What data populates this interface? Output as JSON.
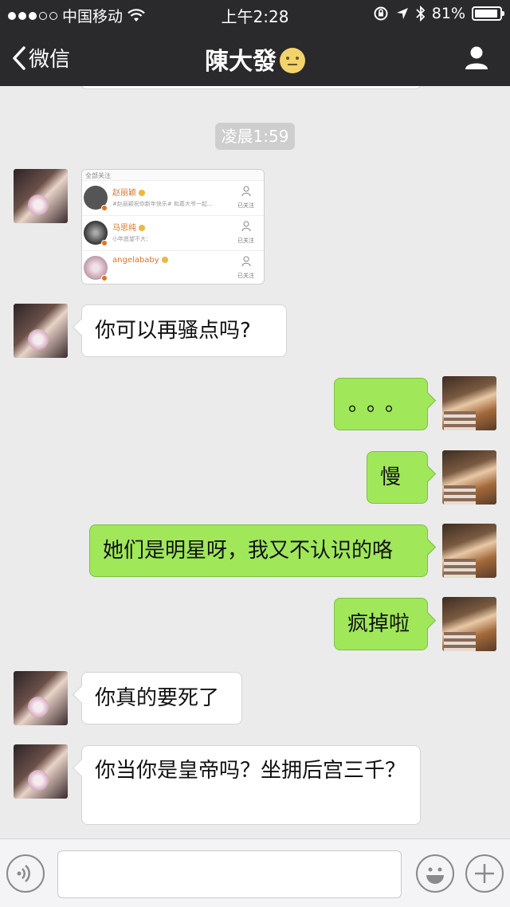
{
  "status_bar": {
    "carrier": "中国移动",
    "time": "上午2:28",
    "battery_percent": "81%",
    "battery_level": 0.81,
    "signal_strength": 3,
    "signal_max": 5
  },
  "nav": {
    "back_label": "微信",
    "title": "陳大發",
    "title_emoji": "moon-face-emoji",
    "profile_icon": "person-icon"
  },
  "chat": {
    "timestamp": "凌晨1:59",
    "shared_screenshot": {
      "header": "全部关注",
      "rows": [
        {
          "name": "赵丽颖",
          "desc": "#赵丽颖祝你新年快乐# 和葛大爷一起...",
          "follow": "已关注"
        },
        {
          "name": "马思纯",
          "desc": "小年愿望不大：",
          "follow": "已关注"
        },
        {
          "name": "angelababy",
          "desc": "",
          "follow": "已关注"
        }
      ]
    },
    "messages": [
      {
        "from": "her",
        "text": "你可以再骚点吗?"
      },
      {
        "from": "me",
        "text": "。。。"
      },
      {
        "from": "me",
        "text": "慢"
      },
      {
        "from": "me",
        "text": "她们是明星呀，我又不认识的咯"
      },
      {
        "from": "me",
        "text": "疯掉啦"
      },
      {
        "from": "her",
        "text": "你真的要死了"
      },
      {
        "from": "her",
        "text": "你当你是皇帝吗？坐拥后宫三千？"
      }
    ]
  },
  "input_bar": {
    "placeholder": "",
    "voice_icon": "voice-icon",
    "emoji_icon": "emoji-icon",
    "plus_icon": "plus-icon"
  },
  "colors": {
    "nav_bg": "#2a2a2d",
    "chat_bg": "#ebebeb",
    "outgoing_bubble": "#a0e75a",
    "incoming_bubble": "#ffffff"
  }
}
